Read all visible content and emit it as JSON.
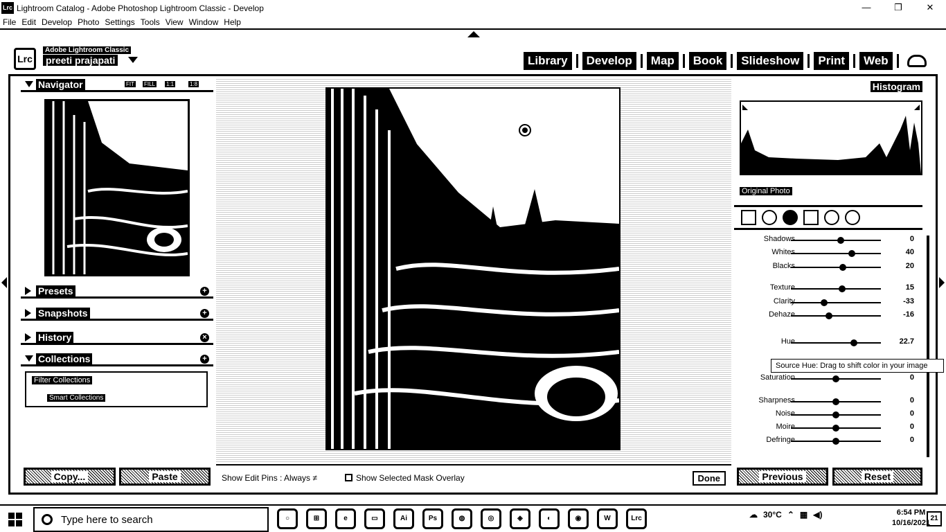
{
  "window": {
    "app_icon": "Lrc",
    "title": "Lightroom Catalog - Adobe Photoshop Lightroom Classic - Develop",
    "minimize": "—",
    "restore": "❐",
    "close": "✕"
  },
  "menu": [
    "File",
    "Edit",
    "Develop",
    "Photo",
    "Settings",
    "Tools",
    "View",
    "Window",
    "Help"
  ],
  "identity": {
    "logo": "Lrc",
    "product": "Adobe Lightroom Classic",
    "user": "preeti prajapati"
  },
  "modules": [
    "Library",
    "Develop",
    "Map",
    "Book",
    "Slideshow",
    "Print",
    "Web"
  ],
  "left_panel": {
    "navigator": {
      "label": "Navigator",
      "zoom": [
        "FIT",
        "FILL",
        "1:1",
        "1:8"
      ]
    },
    "presets": {
      "label": "Presets"
    },
    "snapshots": {
      "label": "Snapshots"
    },
    "history": {
      "label": "History"
    },
    "collections": {
      "label": "Collections",
      "filter": "Filter Collections",
      "smart": "Smart Collections"
    },
    "copy": "Copy...",
    "paste": "Paste"
  },
  "toolbar": {
    "show_edit_pins": "Show Edit Pins : Always ≠",
    "show_mask": "Show Selected Mask Overlay",
    "done": "Done"
  },
  "right_panel": {
    "histogram": "Histogram",
    "original_photo": "Original Photo",
    "sliders": [
      {
        "label": "Shadows",
        "value": "0",
        "pos": 0.55
      },
      {
        "label": "Whites",
        "value": "40",
        "pos": 0.68
      },
      {
        "label": "Blacks",
        "value": "20",
        "pos": 0.58
      },
      {
        "label": "Texture",
        "value": "15",
        "pos": 0.57
      },
      {
        "label": "Clarity",
        "value": "-33",
        "pos": 0.37
      },
      {
        "label": "Dehaze",
        "value": "-16",
        "pos": 0.42
      },
      {
        "label": "Hue",
        "value": "22.7",
        "pos": 0.7
      },
      {
        "label": "Saturation",
        "value": "0",
        "pos": 0.5
      },
      {
        "label": "Sharpness",
        "value": "0",
        "pos": 0.5
      },
      {
        "label": "Noise",
        "value": "0",
        "pos": 0.5
      },
      {
        "label": "Moire",
        "value": "0",
        "pos": 0.5
      },
      {
        "label": "Defringe",
        "value": "0",
        "pos": 0.5
      }
    ],
    "tooltip": "Source Hue: Drag to shift color in your image",
    "previous": "Previous",
    "reset": "Reset"
  },
  "taskbar": {
    "search_placeholder": "Type here to search",
    "apps": [
      "○",
      "⊞",
      "e",
      "▭",
      "Ai",
      "Ps",
      "◍",
      "◎",
      "◈",
      "◐",
      "◉",
      "W",
      "Lrc"
    ],
    "weather": "30°C",
    "time": "6:54 PM",
    "date": "10/16/2021",
    "notifications": "21"
  }
}
